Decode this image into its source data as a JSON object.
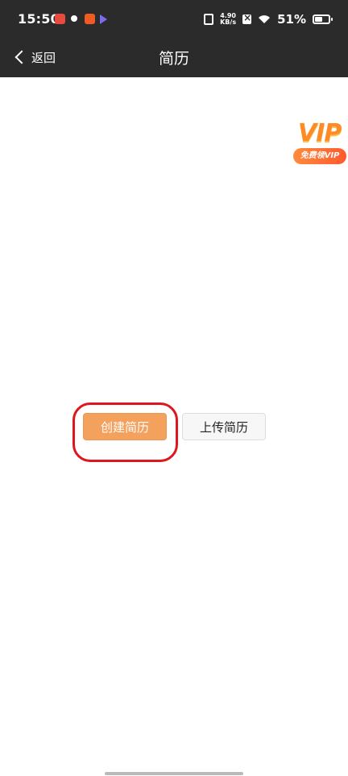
{
  "status_bar": {
    "time": "15:50",
    "net_speed_value": "4.90",
    "net_speed_unit": "KB/s",
    "battery_percent": "51%"
  },
  "nav": {
    "back_label": "返回",
    "title": "简历"
  },
  "vip_badge": {
    "word": "VIP",
    "tag": "免费领VIP"
  },
  "actions": {
    "create_label": "创建简历",
    "upload_label": "上传简历"
  },
  "colors": {
    "header_bg": "#2b2b2b",
    "create_button": "#f4a15e",
    "highlight_ring": "#e0161f"
  },
  "icons": [
    "back-chevron-icon",
    "vibrate-icon",
    "wifi-icon",
    "battery-icon"
  ]
}
